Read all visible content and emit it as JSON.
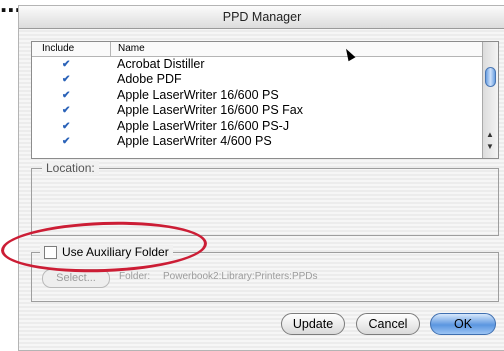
{
  "window": {
    "title": "PPD Manager"
  },
  "list": {
    "columns": [
      "Include",
      "Name"
    ],
    "rows": [
      {
        "include": true,
        "name": "Acrobat Distiller"
      },
      {
        "include": true,
        "name": "Adobe PDF"
      },
      {
        "include": true,
        "name": "Apple LaserWriter 16/600 PS"
      },
      {
        "include": true,
        "name": "Apple LaserWriter 16/600 PS Fax"
      },
      {
        "include": true,
        "name": "Apple LaserWriter 16/600 PS-J"
      },
      {
        "include": true,
        "name": "Apple LaserWriter 4/600 PS"
      }
    ]
  },
  "location": {
    "label": "Location:"
  },
  "aux": {
    "checkbox_label": "Use Auxiliary Folder",
    "checked": false,
    "select_label": "Select...",
    "folder_label": "Folder:",
    "folder_path": "Powerbook2:Library:Printers:PPDs"
  },
  "buttons": {
    "update": "Update",
    "cancel": "Cancel",
    "ok": "OK"
  },
  "colors": {
    "highlight_ring": "#cc1d35",
    "check": "#2a62b8",
    "default_button": "#5b96e0"
  }
}
